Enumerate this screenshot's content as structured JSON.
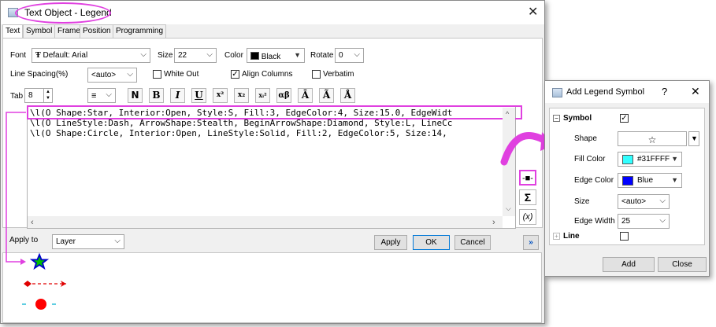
{
  "main_dialog": {
    "title": "Text Object - Legend",
    "tabs": [
      {
        "label": "Text"
      },
      {
        "label": "Symbol"
      },
      {
        "label": "Frame"
      },
      {
        "label": "Position"
      },
      {
        "label": "Programming"
      }
    ],
    "font_label": "Font",
    "font_value": "Default: Arial",
    "size_label": "Size",
    "size_value": "22",
    "color_label": "Color",
    "color_value": "Black",
    "rotate_label": "Rotate",
    "rotate_value": "0",
    "line_spacing_label": "Line Spacing(%)",
    "line_spacing_value": "<auto>",
    "white_out_label": "White Out",
    "white_out_checked": false,
    "align_columns_label": "Align Columns",
    "align_columns_checked": true,
    "verbatim_label": "Verbatim",
    "verbatim_checked": false,
    "tab_label": "Tab",
    "tab_value": "8",
    "format_buttons": [
      "N",
      "B",
      "I",
      "U",
      "x²",
      "x₂",
      "xᵢ²",
      "αβ",
      "Ā",
      "Ã",
      "Å"
    ],
    "code_lines": [
      "\\l(O Shape:Star, Interior:Open, Style:S, Fill:3, EdgeColor:4, Size:15.0, EdgeWidt",
      "\\l(O LineStyle:Dash, ArrowShape:Stealth, BeginArrowShape:Diamond, Style:L, LineCc",
      "\\l(O Shape:Circle, Interior:Open, LineStyle:Solid, Fill:2, EdgeColor:5, Size:14,"
    ],
    "side_buttons": {
      "sigma_glyph": "Σ",
      "var_glyph": "(x)"
    },
    "apply_to_label": "Apply to",
    "apply_to_value": "Layer",
    "apply_label": "Apply",
    "ok_label": "OK",
    "cancel_label": "Cancel",
    "expand_glyph": "»"
  },
  "legend_dialog": {
    "title": "Add Legend Symbol",
    "help_glyph": "?",
    "close_glyph": "✕",
    "symbol_group_label": "Symbol",
    "symbol_checked": true,
    "shape_label": "Shape",
    "shape_value": "☆",
    "fill_color_label": "Fill Color",
    "fill_color_value": "#31FFFF",
    "edge_color_label": "Edge Color",
    "edge_color_value": "Blue",
    "size_label": "Size",
    "size_value": "<auto>",
    "edge_width_label": "Edge Width",
    "edge_width_value": "25",
    "line_group_label": "Line",
    "line_checked": false,
    "add_label": "Add",
    "close_label": "Close"
  },
  "colors": {
    "highlight": "#e040e0",
    "fill_swatch": "#31FFFF",
    "edge_swatch": "#0000FF",
    "star_fill": "#00c000",
    "star_edge": "#0000cc",
    "arrow": "#e00000",
    "circle": "#ff0000",
    "circle_line": "#00b0d0"
  }
}
